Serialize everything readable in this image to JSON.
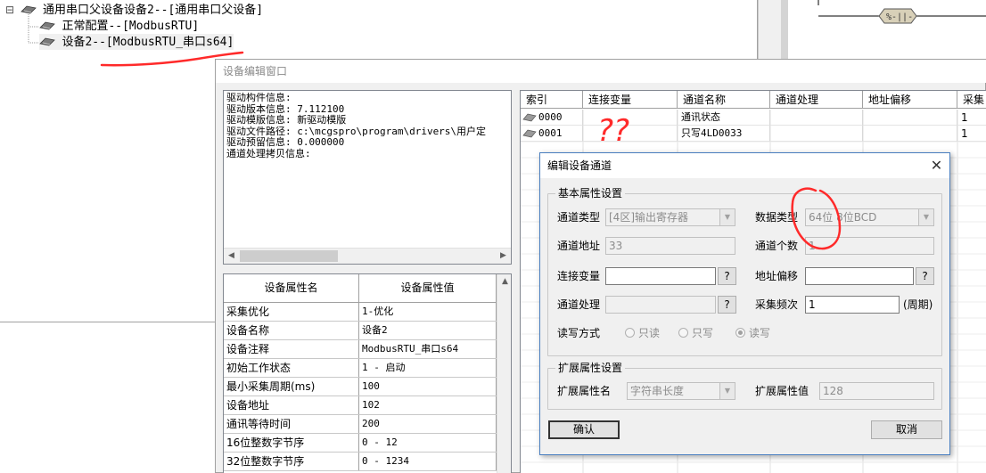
{
  "tree": {
    "items": [
      {
        "prefix": "⊟",
        "label": "通用串口父设备设备2--[通用串口父设备]"
      },
      {
        "prefix": "",
        "label": "正常配置--[ModbusRTU]"
      },
      {
        "prefix": "",
        "label": "设备2--[ModbusRTU_串口s64]"
      }
    ]
  },
  "device_window": {
    "title": "设备编辑窗口",
    "info_lines": [
      "驱动构件信息:",
      "驱动版本信息: 7.112100",
      "驱动模版信息: 新驱动模版",
      "驱动文件路径: c:\\mcgspro\\program\\drivers\\用户定",
      "驱动预留信息: 0.000000",
      "通道处理拷贝信息:"
    ],
    "prop_headers": [
      "设备属性名",
      "设备属性值"
    ],
    "prop_rows": [
      {
        "name": "采集优化",
        "value": "1-优化"
      },
      {
        "name": "设备名称",
        "value": "设备2"
      },
      {
        "name": "设备注释",
        "value": "ModbusRTU_串口s64"
      },
      {
        "name": "初始工作状态",
        "value": "1 - 启动"
      },
      {
        "name": "最小采集周期(ms)",
        "value": "100"
      },
      {
        "name": "设备地址",
        "value": "102"
      },
      {
        "name": "通讯等待时间",
        "value": "200"
      },
      {
        "name": "16位整数字节序",
        "value": "0 - 12"
      },
      {
        "name": "32位整数字节序",
        "value": "0 - 1234"
      }
    ],
    "channel_headers": [
      "索引",
      "连接变量",
      "通道名称",
      "通道处理",
      "地址偏移",
      "采集"
    ],
    "channel_rows": [
      {
        "index": "0000",
        "variable": "",
        "name": "通讯状态",
        "process": "",
        "offset": "",
        "freq": "1"
      },
      {
        "index": "0001",
        "variable": "",
        "name": "只写4LD0033",
        "process": "",
        "offset": "",
        "freq": "1"
      }
    ]
  },
  "dialog": {
    "title": "编辑设备通道",
    "close_glyph": "✕",
    "basic_group": "基本属性设置",
    "channel_type_label": "通道类型",
    "channel_type_value": "[4区]输出寄存器",
    "data_type_label": "数据类型",
    "data_type_value": "64位 8位BCD",
    "channel_addr_label": "通道地址",
    "channel_addr_value": "33",
    "channel_count_label": "通道个数",
    "channel_count_value": "1",
    "link_var_label": "连接变量",
    "link_var_value": "",
    "addr_offset_label": "地址偏移",
    "addr_offset_value": "",
    "channel_proc_label": "通道处理",
    "channel_proc_value": "",
    "collect_freq_label": "采集频次",
    "collect_freq_value": "1",
    "collect_freq_unit": "(周期)",
    "rw_label": "读写方式",
    "rw_options": [
      "只读",
      "只写",
      "读写"
    ],
    "rw_selected": "读写",
    "question_mark": "?",
    "ext_group": "扩展属性设置",
    "ext_name_label": "扩展属性名",
    "ext_name_value": "字符串长度",
    "ext_value_label": "扩展属性值",
    "ext_value_value": "128",
    "ok_label": "确认",
    "cancel_label": "取消"
  },
  "annotations": {
    "question_marks": "??",
    "ink_color": "#ff2a2a"
  }
}
